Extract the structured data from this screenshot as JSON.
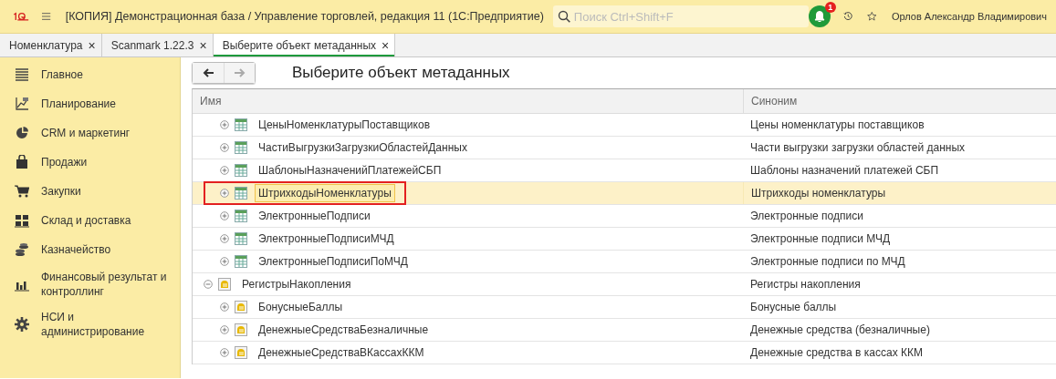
{
  "window": {
    "title": "[КОПИЯ] Демонстрационная база / Управление торговлей, редакция 11  (1С:Предприятие)"
  },
  "search": {
    "placeholder": "Поиск Ctrl+Shift+F"
  },
  "notifications": {
    "count": "1"
  },
  "user": {
    "name": "Орлов Александр Владимирович"
  },
  "tabs": [
    {
      "label": "Номенклатура",
      "selected": false,
      "close": "×"
    },
    {
      "label": "Scanmark 1.22.3",
      "selected": false,
      "close": "×"
    },
    {
      "label": "Выберите объект метаданных",
      "selected": true,
      "close": "×"
    }
  ],
  "sidebar": {
    "items": [
      {
        "label": "Главное",
        "kind": "lines"
      },
      {
        "label": "Планирование",
        "kind": "chart"
      },
      {
        "label": "CRM и маркетинг",
        "kind": "pie"
      },
      {
        "label": "Продажи",
        "kind": "bag"
      },
      {
        "label": "Закупки",
        "kind": "cart"
      },
      {
        "label": "Склад и доставка",
        "kind": "blocks"
      },
      {
        "label": "Казначейство",
        "kind": "coins"
      },
      {
        "label": "Финансовый результат и контроллинг",
        "kind": "bars"
      },
      {
        "label": "НСИ и администрирование",
        "kind": "gear"
      }
    ]
  },
  "form": {
    "title": "Выберите объект метаданных",
    "table": {
      "columns": [
        "Имя",
        "Синоним"
      ],
      "continued_children": [
        {
          "name": "ЦеныНоменклатурыПоставщиков",
          "synonym": "Цены номенклатуры поставщиков",
          "kind": "info_register",
          "expanded": false,
          "selected": false,
          "annotated": false
        },
        {
          "name": "ЧастиВыгрузкиЗагрузкиОбластейДанных",
          "synonym": "Части выгрузки загрузки областей данных",
          "kind": "info_register",
          "expanded": false,
          "selected": false,
          "annotated": false
        },
        {
          "name": "ШаблоныНазначенийПлатежейСБП",
          "synonym": "Шаблоны назначений платежей СБП",
          "kind": "info_register",
          "expanded": false,
          "selected": false,
          "annotated": false
        },
        {
          "name": "ШтрихкодыНоменклатуры",
          "synonym": "Штрихкоды номенклатуры",
          "kind": "info_register",
          "expanded": false,
          "selected": true,
          "annotated": true
        },
        {
          "name": "ЭлектронныеПодписи",
          "synonym": "Электронные подписи",
          "kind": "info_register",
          "expanded": false,
          "selected": false,
          "annotated": false
        },
        {
          "name": "ЭлектронныеПодписиМЧД",
          "synonym": "Электронные подписи МЧД",
          "kind": "info_register",
          "expanded": false,
          "selected": false,
          "annotated": false
        },
        {
          "name": "ЭлектронныеПодписиПоМЧД",
          "synonym": "Электронные подписи по МЧД",
          "kind": "info_register",
          "expanded": false,
          "selected": false,
          "annotated": false
        }
      ],
      "nodes": [
        {
          "name": "РегистрыНакопления",
          "synonym": "Регистры накопления",
          "kind": "accumulation_register",
          "expanded": true,
          "selected": false,
          "annotated": false,
          "children": [
            {
              "name": "БонусныеБаллы",
              "synonym": "Бонусные баллы",
              "kind": "accumulation_register",
              "expanded": false,
              "selected": false,
              "annotated": false
            },
            {
              "name": "ДенежныеСредстваБезналичные",
              "synonym": "Денежные средства (безналичные)",
              "kind": "accumulation_register",
              "expanded": false,
              "selected": false,
              "annotated": false
            },
            {
              "name": "ДенежныеСредстваВКассахККМ",
              "synonym": "Денежные средства в кассах ККМ",
              "kind": "accumulation_register",
              "expanded": false,
              "selected": false,
              "annotated": false
            }
          ]
        }
      ]
    }
  }
}
